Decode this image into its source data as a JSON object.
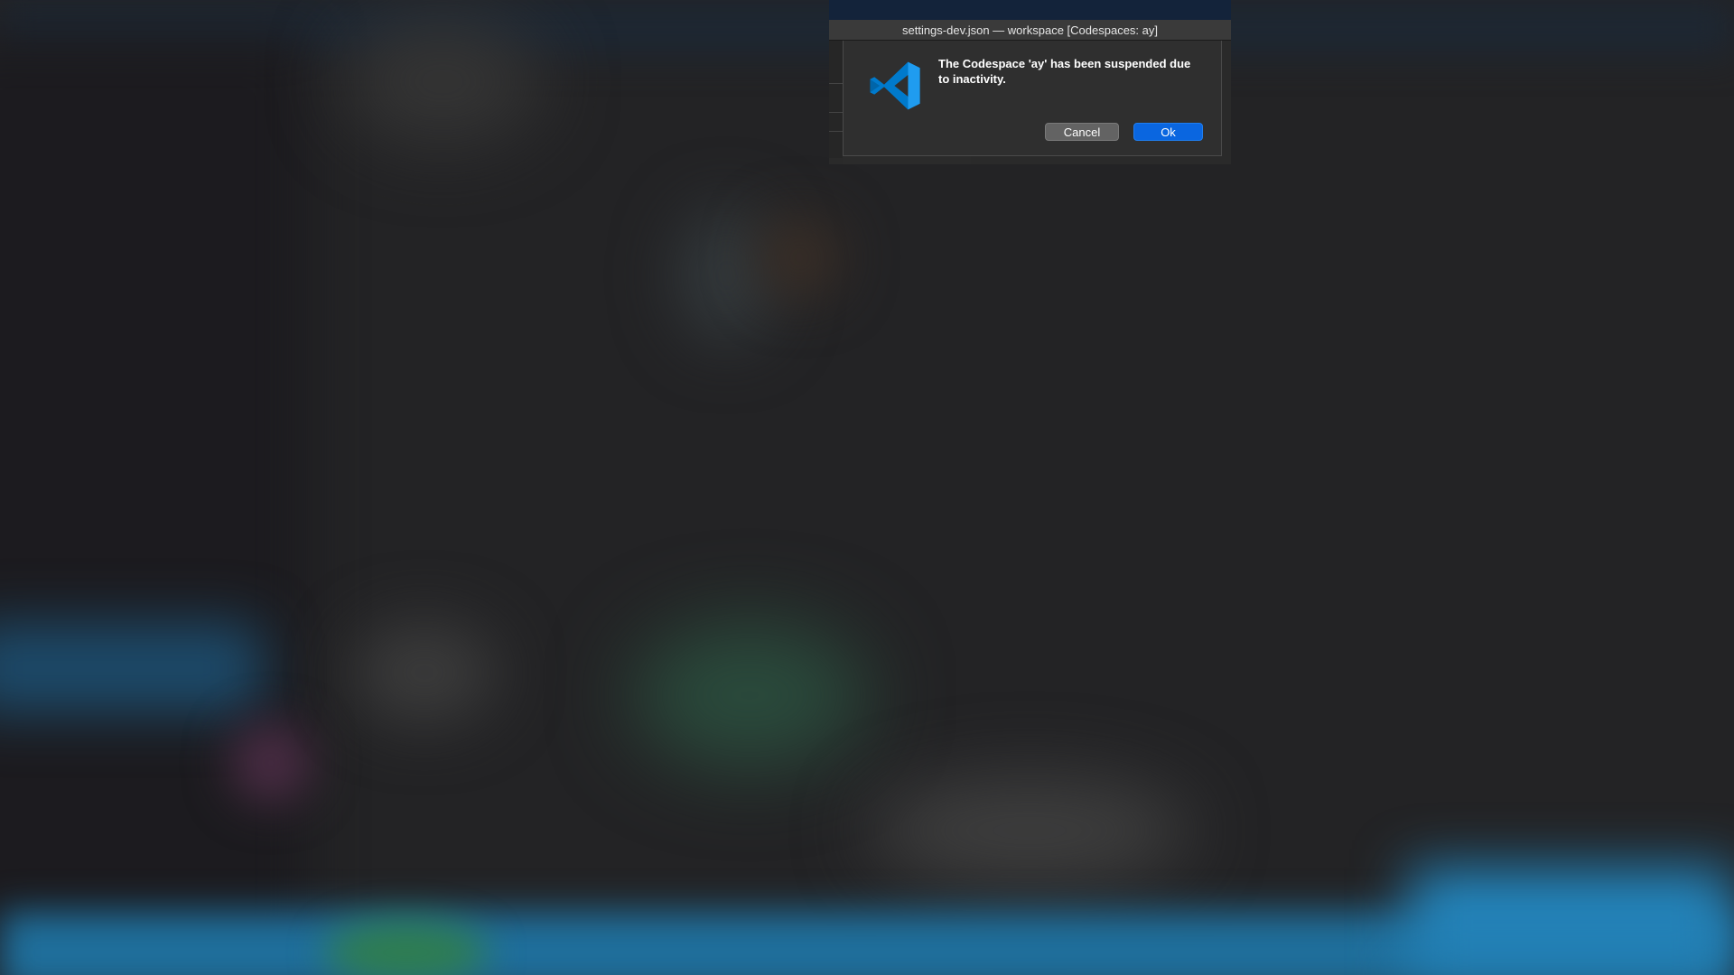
{
  "window": {
    "title": "settings-dev.json — workspace [Codespaces: ay]"
  },
  "dialog": {
    "icon": "vscode-logo-icon",
    "message": "The Codespace 'ay' has been suspended due to inactivity.",
    "cancel_label": "Cancel",
    "ok_label": "Ok"
  },
  "colors": {
    "accent": "#0a66e0",
    "vscode_blue": "#0065a9"
  }
}
